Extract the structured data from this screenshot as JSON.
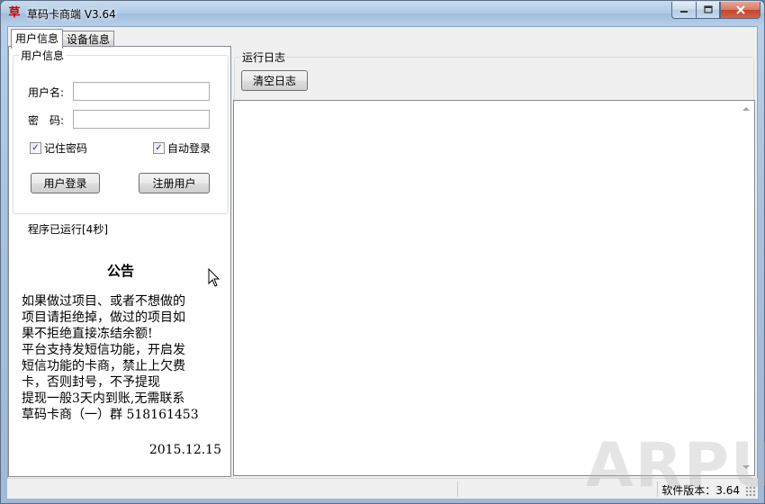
{
  "window": {
    "icon": "草",
    "title": "草码卡商端 V3.64"
  },
  "tabs": [
    {
      "label": "用户信息",
      "active": true
    },
    {
      "label": "设备信息",
      "active": false
    }
  ],
  "user_group": {
    "title": "用户信息",
    "username_label": "用户名:",
    "username_value": "",
    "password_label": "密　码:",
    "password_value": "",
    "remember_label": "记住密码",
    "remember_checked": true,
    "autologin_label": "自动登录",
    "autologin_checked": true,
    "login_button": "用户登录",
    "register_button": "注册用户",
    "runtime_text": "程序已运行[4秒]"
  },
  "notice": {
    "title": "公告",
    "body": "如果做过项目、或者不想做的\n项目请拒绝掉，做过的项目如\n果不拒绝直接冻结余额!\n平台支持发短信功能，开启发\n短信功能的卡商，禁止上欠费\n卡，否则封号，不予提现\n提现一般3天内到账,无需联系\n草码卡商（一）群 518161453",
    "date": "2015.12.15"
  },
  "log": {
    "title": "运行日志",
    "clear_button": "清空日志",
    "content": ""
  },
  "statusbar": {
    "version_text": "软件版本：3.64"
  },
  "watermark": "ARPUN",
  "icons": {
    "app": "app-icon",
    "minimize": "minimize-icon",
    "maximize": "maximize-icon",
    "close": "close-icon",
    "cursor": "mouse-cursor-icon"
  }
}
